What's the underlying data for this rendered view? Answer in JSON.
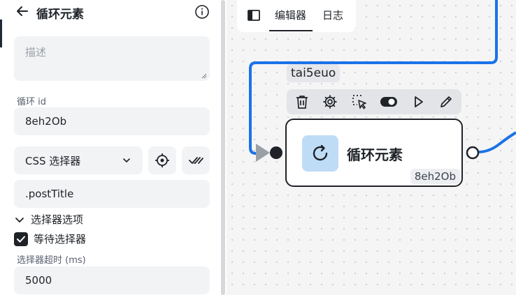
{
  "sidebar": {
    "title": "循环元素",
    "description_placeholder": "描述",
    "loop_id_label": "循环 id",
    "loop_id_value": "8eh2Ob",
    "selector_type": "CSS 选择器",
    "selector_value": ".postTitle",
    "selector_options_label": "选择器选项",
    "wait_selector_label": "等待选择器",
    "wait_selector_checked": true,
    "timeout_label": "选择器超时 (ms)",
    "timeout_value": "5000"
  },
  "canvas": {
    "tabs": [
      {
        "label": "编辑器",
        "active": true
      },
      {
        "label": "日志",
        "active": false
      }
    ],
    "node_tag": "tai5euo",
    "node": {
      "title": "循环元素",
      "id": "8eh2Ob",
      "icon": "refresh-icon"
    },
    "toolbar_icons": [
      "trash-icon",
      "gear-icon",
      "select-pointer-icon",
      "toggle-icon",
      "play-icon",
      "pencil-icon"
    ],
    "edge_color": "#1a73e8"
  }
}
